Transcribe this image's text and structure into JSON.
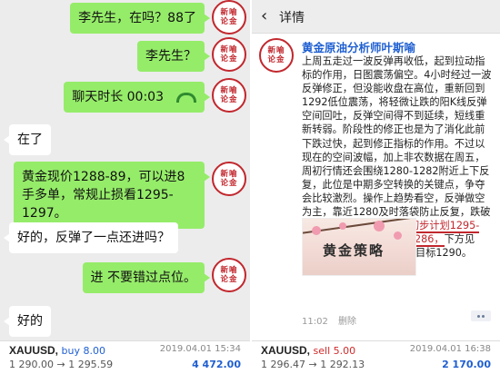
{
  "left_chat": {
    "messages": [
      {
        "side": "right",
        "text": "李先生，在吗？88了"
      },
      {
        "side": "right",
        "text": "李先生？"
      },
      {
        "side": "right",
        "text": "聊天时长 00:03"
      },
      {
        "side": "left",
        "text": "在了"
      },
      {
        "side": "right",
        "text": "黄金现价1288-89，可以进8手多单，常规止损看1295-1297。"
      },
      {
        "side": "left",
        "text": "好的，反弹了一点还进吗？"
      },
      {
        "side": "right",
        "text": "进 不要错过点位。"
      },
      {
        "side": "left",
        "text": "好的"
      }
    ],
    "trade": {
      "symbol": "XAUUSD,",
      "side": "buy 8.00",
      "date": "2019.04.01 15:34",
      "prices": "1 290.00 → 1 295.59",
      "profit": "4 472.00"
    }
  },
  "avatar": {
    "line1": "新喻",
    "line2": "论金"
  },
  "right_post": {
    "header_title": "详情",
    "back_icon": "‹",
    "author": "黄金原油分析师叶斯喻",
    "body_before": "上周五走过一波反弹再收低，起到拉动指标的作用，日图震荡偏空。4小时经过一波反弹修正，但没能收盘在高位，重新回到1292低位震荡，将轻微让跌的阳K线反弹空间回吐，反弹空间得不到延续，短线重新转弱。阶段性的修正也是为了消化此前下跌过快，起到修正指标的作用。不过以现在的空间波幅，加上非农数据在周五，周初行情还会围绕1280-1282附近上下反复，此位是中期多空转换的关键点，争夺会比较激烈。操作上趋势看空，反弹做空为主，靠近1280及时落袋防止反复，跌破1280后再看空间放大。",
    "body_hl": "初步计划1295-1297做空，目标1288-1286，",
    "body_after": "下方见1282-83轻仓短多一次，目标1290。",
    "poster_text": "黄金策略",
    "time": "11:02",
    "delete_label": "删除",
    "trade": {
      "symbol": "XAUUSD,",
      "side": "sell 5.00",
      "date": "2019.04.01 16:38",
      "prices": "1 296.47 → 1 292.13",
      "profit": "2 170.00"
    }
  },
  "colors": {
    "wechat_green": "#95ec69",
    "seal_red": "#c1272d",
    "buy_blue": "#1f5fd1",
    "sell_red": "#d12a2a"
  }
}
